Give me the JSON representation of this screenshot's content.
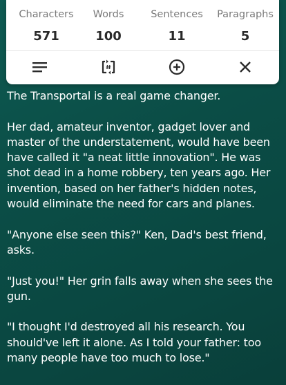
{
  "stats": [
    {
      "label": "Characters",
      "value": "571"
    },
    {
      "label": "Words",
      "value": "100"
    },
    {
      "label": "Sentences",
      "value": "11"
    },
    {
      "label": "Paragraphs",
      "value": "5"
    }
  ],
  "toolbar": {
    "icons": [
      "menu-icon",
      "count-refresh-icon",
      "add-circle-icon",
      "close-icon"
    ],
    "icon_color": "#2a2a2a"
  },
  "text": {
    "paragraphs": [
      "The Transportal is a real game changer.",
      "Her dad, amateur inventor, gadget lover and master of the understatement, would have been have called it \"a neat little innovation\". He was shot dead in a home robbery, ten years ago. Her invention, based on her father's hidden notes, would eliminate the need for cars and planes.",
      "\"Anyone else seen this?\" Ken, Dad's best friend, asks.",
      "\"Just you!\" Her grin falls away when she sees the gun.",
      "\"I thought I'd destroyed all his research. You should've left it alone. As I told your father: too many people have too much to lose.\""
    ]
  },
  "colors": {
    "background": "#0b4d46",
    "card": "#ffffff",
    "text": "#ffffff",
    "label": "#7a7a7a"
  }
}
